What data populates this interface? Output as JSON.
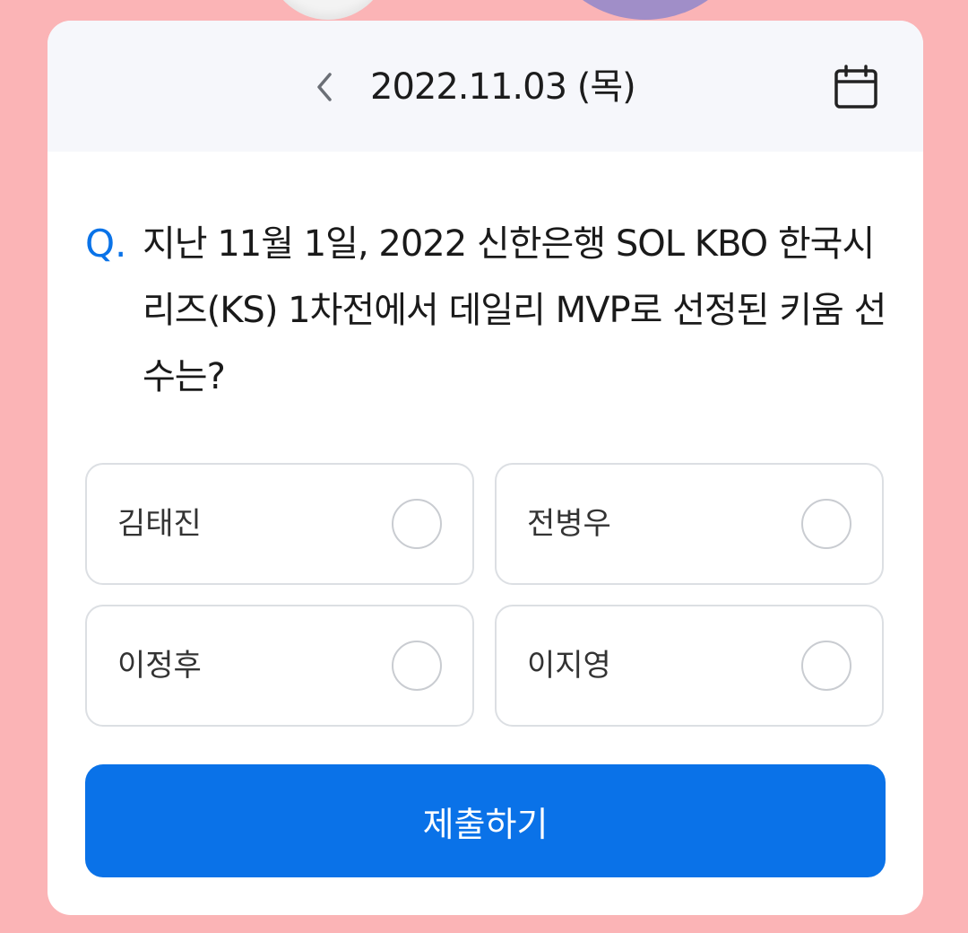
{
  "header": {
    "date": "2022.11.03 (목)",
    "prev_icon": "chevron-left-icon",
    "calendar_icon": "calendar-icon"
  },
  "quiz": {
    "q_mark": "Q.",
    "question": "지난 11월 1일, 2022 신한은행 SOL KBO 한국시리즈(KS) 1차전에서 데일리 MVP로 선정된 키움 선수는?",
    "options": [
      "김태진",
      "전병우",
      "이정후",
      "이지영"
    ],
    "submit_label": "제출하기"
  },
  "colors": {
    "accent": "#0a72e8",
    "page_background": "#fbb4b6",
    "header_background": "#f6f7fb"
  }
}
